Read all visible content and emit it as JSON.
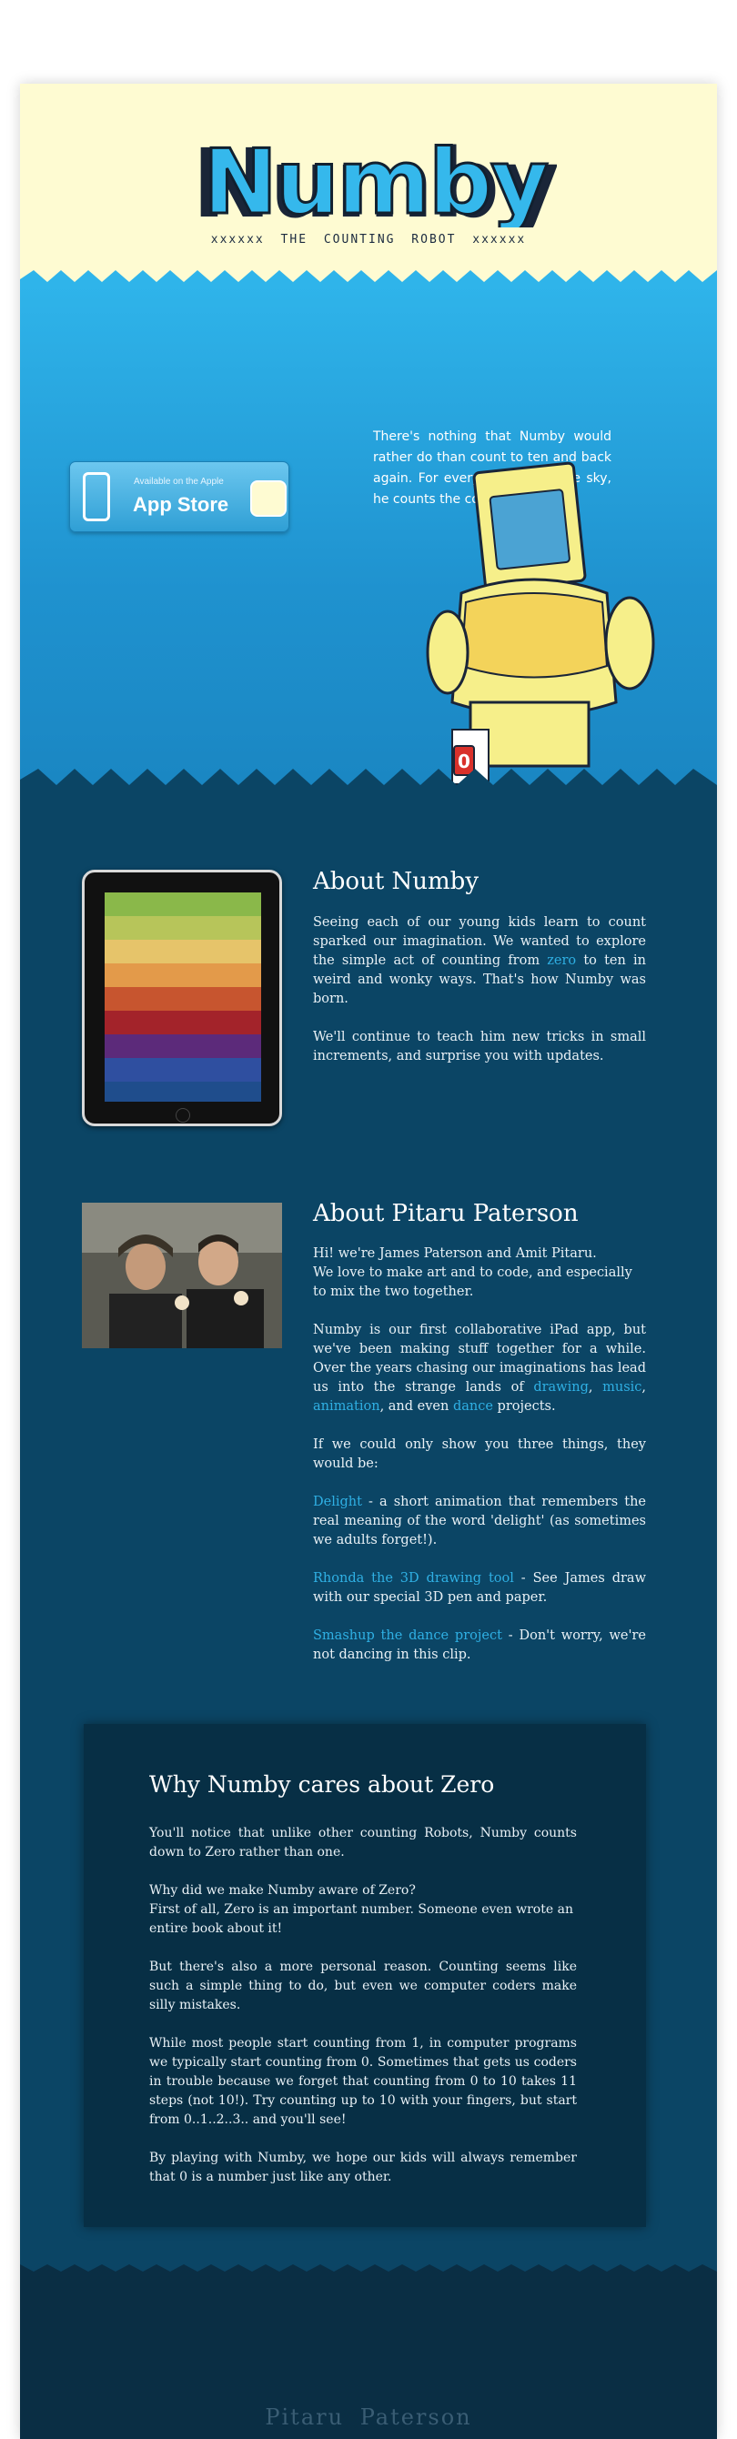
{
  "header": {
    "logo_text": "Numby",
    "tagline": "xxxxxx THE COUNTING ROBOT xxxxxx"
  },
  "hero": {
    "intro": "There's nothing that Numby would rather do than count to ten and back again. For every rainbow in the sky, he counts the colors he can spy.",
    "appstore_small": "Available on the Apple",
    "appstore_big": "App Store",
    "robot_counter": "0"
  },
  "about_numby": {
    "title": "About Numby",
    "p1_before": "Seeing each of our young kids learn to count sparked our imagination. We wanted to explore the simple act of counting from ",
    "p1_link": "zero",
    "p1_after": " to ten in weird and wonky ways. That's how Numby was born.",
    "p2": "We'll continue to teach him new tricks in small increments, and surprise you with updates."
  },
  "about_pp": {
    "title": "About Pitaru Paterson",
    "p1a": "Hi! we're James Paterson and Amit Pitaru.",
    "p1b": "We love to make art and to code, and especially to mix the two together.",
    "p2_before": "Numby is our first collaborative iPad app, but we've been making stuff together for a while. Over the years chasing our imaginations has lead us into the strange lands of ",
    "p2_links": [
      "drawing",
      "music",
      "animation",
      "dance"
    ],
    "p2_sep1": ", ",
    "p2_sep2": ", ",
    "p2_sep3": ", and even ",
    "p2_after": " projects.",
    "p3": "If we could only show you three things, they would be:",
    "items": [
      {
        "link": "Delight",
        "text": " - a short animation that remembers the real meaning of the word 'delight' (as sometimes we adults forget!)."
      },
      {
        "link": "Rhonda the 3D drawing tool",
        "text": " - See James draw with our special 3D pen and paper."
      },
      {
        "link": "Smashup the dance project",
        "text": " - Don't worry, we're not dancing in this clip."
      }
    ]
  },
  "zero": {
    "title": "Why Numby cares about Zero",
    "p1": "You'll notice that unlike other counting Robots, Numby counts down to Zero rather than one.",
    "p2a": "Why did we make Numby aware of Zero?",
    "p2b": "First of all, Zero is an important number. Someone even wrote an entire book about it!",
    "p3": "But there's also a more personal reason. Counting seems like such a simple thing to do, but even we computer coders make silly mistakes.",
    "p4": "While most people start counting from 1, in computer programs we typically start counting from 0. Sometimes that gets us coders in trouble because we forget that counting from 0 to 10 takes 11 steps (not 10!). Try counting up to 10 with your fingers, but start from 0..1..2..3.. and you'll see!",
    "p5": "By playing with Numby, we hope our kids will always remember that 0 is a number just like any other."
  },
  "footer": {
    "text": "Pitaru Paterson"
  },
  "colors": {
    "header_bg": "#fefbd2",
    "hero_blue": "#1f9bd7",
    "main_bg": "#0b4565",
    "box_bg": "#072f45",
    "footer_bg": "#0a2e44",
    "link": "#2fb0e4"
  }
}
